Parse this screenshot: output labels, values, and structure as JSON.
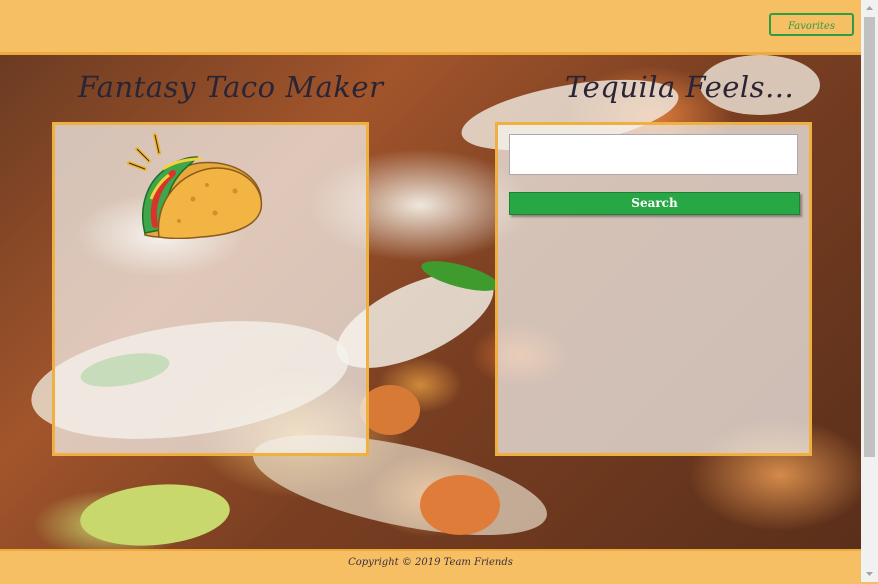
{
  "header": {
    "favorites_label": "Favorites",
    "accent": "#f6bf63",
    "button_color": "#2d9e46"
  },
  "left_panel": {
    "title": "Fantasy Taco Maker",
    "image_icon": "taco-icon"
  },
  "right_panel": {
    "title": "Tequila Feels...",
    "search_value": "",
    "search_button_label": "Search",
    "button_color": "#28a745"
  },
  "footer": {
    "text": "Copyright © 2019 Team Friends"
  },
  "scrollbar": {
    "up_icon": "arrow-up-icon",
    "down_icon": "arrow-down-icon"
  }
}
